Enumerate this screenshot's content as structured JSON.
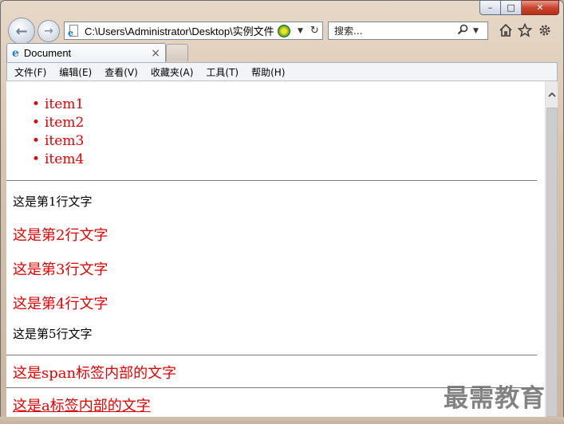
{
  "window": {
    "minimize_glyph": "–",
    "maximize_glyph": "□",
    "close_glyph": "✕"
  },
  "toolbar": {
    "back_glyph": "←",
    "forward_glyph": "→",
    "address": "C:\\Users\\Administrator\\Desktop\\实例文件",
    "search_placeholder": "搜索...",
    "icons": [
      "back-icon",
      "forward-icon",
      "page-icon",
      "compatibility-view-icon",
      "dropdown-icon",
      "refresh-icon",
      "search-icon",
      "home-icon",
      "favorites-star-icon",
      "gear-icon"
    ]
  },
  "tab": {
    "title": "Document",
    "close_glyph": "×"
  },
  "menubar": {
    "items": [
      "文件(F)",
      "编辑(E)",
      "查看(V)",
      "收藏夹(A)",
      "工具(T)",
      "帮助(H)"
    ]
  },
  "page": {
    "list_items": [
      "item1",
      "item2",
      "item3",
      "item4"
    ],
    "lines": [
      "这是第1行文字",
      "这是第2行文字",
      "这是第3行文字",
      "这是第4行文字",
      "这是第5行文字"
    ],
    "span_text": "这是span标签内部的文字",
    "link_text": "这是a标签内部的文字",
    "text_colors": {
      "red": "#e60000",
      "black": "#000000"
    }
  },
  "watermark": "最需教育"
}
